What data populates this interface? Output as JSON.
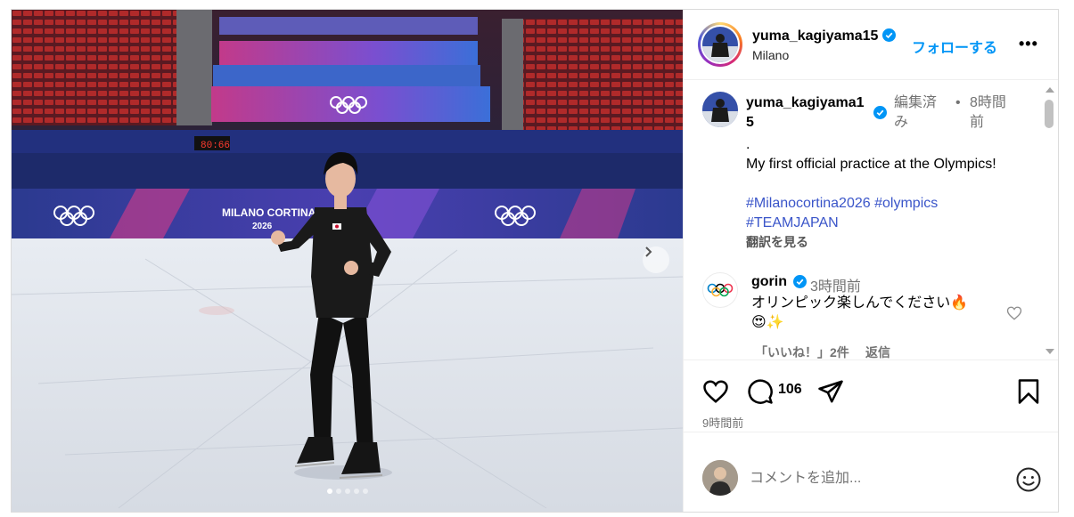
{
  "post": {
    "username": "yuma_kagiyama15",
    "location": "Milano",
    "follow_label": "フォローする",
    "more_label": "•••",
    "media": {
      "ice_color": "#dfe4ec",
      "rink_board_color": "#2b3a8f",
      "seat_color": "#b02a2a",
      "banner_texts": [
        "MILANO CORTINA",
        "2026"
      ],
      "scoreboard_text": "80:66",
      "dots_total": 5,
      "dots_active_index": 0
    },
    "caption": {
      "username_line1": "yuma_kagiyama1",
      "username_line2": "5",
      "edited_line1": "編集済",
      "edited_line2": "み",
      "separator": "•",
      "time_line1": "8時間",
      "time_line2": "前",
      "text": ".\nMy first official practice at the Olympics!",
      "hashtags": [
        "#Milanocortina2026",
        "#olympics",
        "#TEAMJAPAN"
      ],
      "translate_label": "翻訳を見る"
    },
    "comment": {
      "username": "gorin",
      "time": "3時間前",
      "text": "オリンピック楽しんでください🔥\n😍✨",
      "likes_label": "「いいね！」2件",
      "reply_label": "返信"
    },
    "actions": {
      "comment_count": "106",
      "post_time": "9時間前"
    },
    "add_comment": {
      "placeholder": "コメントを追加..."
    },
    "colors": {
      "link_blue": "#0095f6",
      "hashtag_blue": "#3a55c9",
      "verified_blue": "#0095f6",
      "muted_gray": "#737373"
    }
  }
}
